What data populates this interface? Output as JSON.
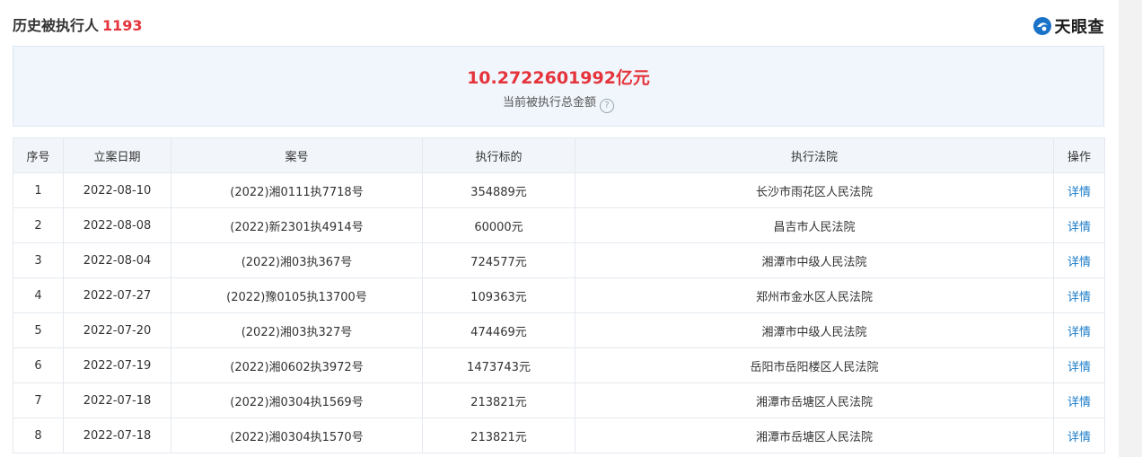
{
  "header": {
    "title": "历史被执行人",
    "count": "1193",
    "brand": "天眼查"
  },
  "summary": {
    "amount": "10.2722601992亿元",
    "caption": "当前被执行总金额",
    "help_glyph": "?"
  },
  "table": {
    "columns": [
      "序号",
      "立案日期",
      "案号",
      "执行标的",
      "执行法院",
      "操作"
    ],
    "rows": [
      {
        "no": "1",
        "date": "2022-08-10",
        "case": "(2022)湘0111执7718号",
        "amount": "354889元",
        "court": "长沙市雨花区人民法院",
        "action": "详情"
      },
      {
        "no": "2",
        "date": "2022-08-08",
        "case": "(2022)新2301执4914号",
        "amount": "60000元",
        "court": "昌吉市人民法院",
        "action": "详情"
      },
      {
        "no": "3",
        "date": "2022-08-04",
        "case": "(2022)湘03执367号",
        "amount": "724577元",
        "court": "湘潭市中级人民法院",
        "action": "详情"
      },
      {
        "no": "4",
        "date": "2022-07-27",
        "case": "(2022)豫0105执13700号",
        "amount": "109363元",
        "court": "郑州市金水区人民法院",
        "action": "详情"
      },
      {
        "no": "5",
        "date": "2022-07-20",
        "case": "(2022)湘03执327号",
        "amount": "474469元",
        "court": "湘潭市中级人民法院",
        "action": "详情"
      },
      {
        "no": "6",
        "date": "2022-07-19",
        "case": "(2022)湘0602执3972号",
        "amount": "1473743元",
        "court": "岳阳市岳阳楼区人民法院",
        "action": "详情"
      },
      {
        "no": "7",
        "date": "2022-07-18",
        "case": "(2022)湘0304执1569号",
        "amount": "213821元",
        "court": "湘潭市岳塘区人民法院",
        "action": "详情"
      },
      {
        "no": "8",
        "date": "2022-07-18",
        "case": "(2022)湘0304执1570号",
        "amount": "213821元",
        "court": "湘潭市岳塘区人民法院",
        "action": "详情"
      }
    ]
  },
  "colors": {
    "accent_red": "#e5343b",
    "link_blue": "#1b7cc8",
    "brand_blue": "#1a73c8"
  },
  "icons": {
    "brand_logo": "tianyancha-logo-icon",
    "help": "question-circle-icon"
  }
}
